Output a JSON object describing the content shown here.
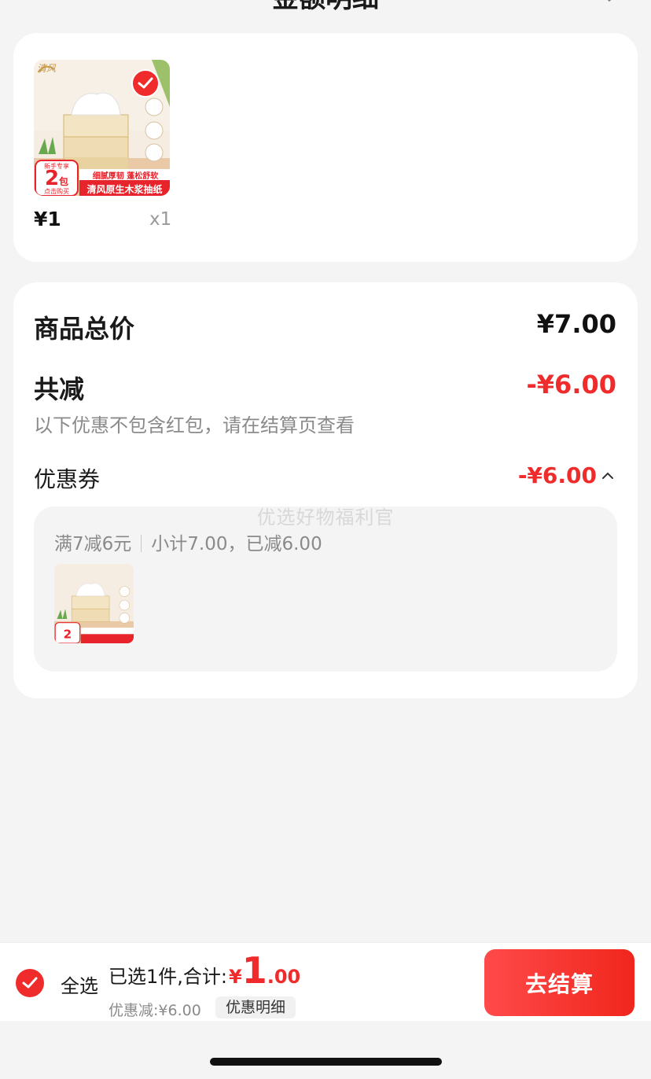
{
  "header": {
    "title": "金额明细"
  },
  "product": {
    "price": "¥1",
    "qty": "x1",
    "image_texts": {
      "brand": "清风",
      "pack_count": "2",
      "pack_unit": "包",
      "banner_small": "细腻厚韧 蓬松舒软",
      "banner_big": "清风原生木浆抽纸",
      "promo_top": "新手专享",
      "promo_bottom": "点击购买"
    }
  },
  "summary": {
    "total_label": "商品总价",
    "total_value": "¥7.00",
    "reduce_label": "共减",
    "reduce_value": "-¥6.00",
    "reduce_note": "以下优惠不包含红包，请在结算页查看",
    "coupon_label": "优惠券",
    "coupon_value": "-¥6.00",
    "watermark": "优选好物福利官",
    "coupon_rule": "满7减6元",
    "coupon_detail": "小计7.00，已减6.00"
  },
  "bottom_bar": {
    "select_all": "全选",
    "selected_prefix": "已选1件,合计:",
    "currency": "¥",
    "amount_int": "1",
    "amount_dec": ".00",
    "discount": "优惠减:¥6.00",
    "detail_chip": "优惠明细",
    "checkout": "去结算"
  },
  "colors": {
    "accent": "#ef2b2b",
    "background": "#f4f4f4",
    "card": "#ffffff"
  },
  "icons": [
    "close-icon",
    "check-icon",
    "chevron-up-icon"
  ]
}
